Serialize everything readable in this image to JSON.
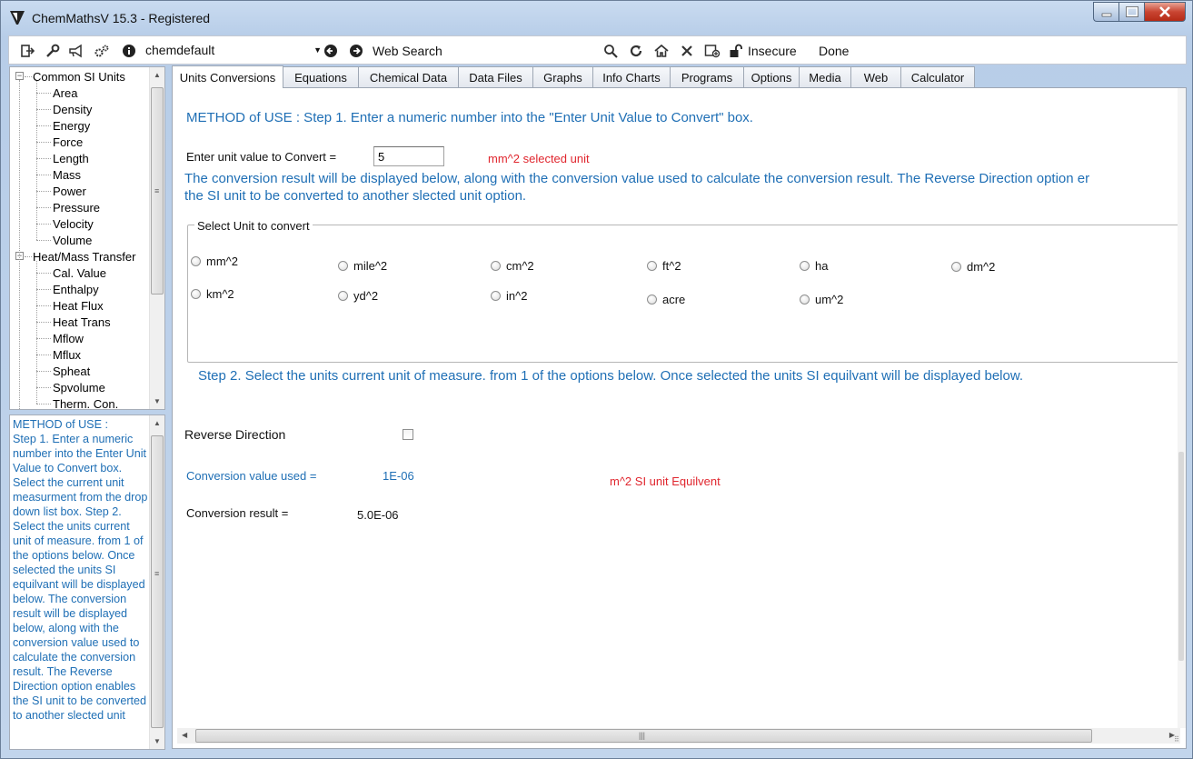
{
  "window": {
    "title": "ChemMathsV 15.3 - Registered"
  },
  "toolbar": {
    "profile": "chemdefault",
    "web_search_label": "Web Search",
    "security_label": "Insecure",
    "status_label": "Done"
  },
  "tree": {
    "groups": [
      {
        "label": "Common SI Units",
        "items": [
          "Area",
          "Density",
          "Energy",
          "Force",
          "Length",
          "Mass",
          "Power",
          "Pressure",
          "Velocity",
          "Volume"
        ]
      },
      {
        "label": "Heat/Mass Transfer",
        "items": [
          "Cal. Value",
          "Enthalpy",
          "Heat Flux",
          "Heat Trans",
          "Mflow",
          "Mflux",
          "Spheat",
          "Spvolume",
          "Therm. Con."
        ]
      }
    ]
  },
  "help": {
    "text": "METHOD of USE :\nStep  1.  Enter a numeric number into the Enter Unit Value to Convert box. Select the current unit measurment from the drop down list box. Step 2. Select the units current unit of measure. from 1 of the options below. Once selected the units SI equilvant will be displayed below. The conversion result will be displayed below, along with the conversion value used to calculate the conversion result. The Reverse Direction option enables the SI unit to be converted to another slected unit"
  },
  "tabs": [
    "Units Conversions",
    "Equations",
    "Chemical Data",
    "Data Files",
    "Graphs",
    "Info Charts",
    "Programs",
    "Options",
    "Media",
    "Web",
    "Calculator"
  ],
  "active_tab": "Units Conversions",
  "content": {
    "method_heading": "METHOD of USE : Step  1.  Enter a numeric number into the \"Enter Unit Value to Convert\" box.",
    "enter_label": "Enter unit value to Convert =",
    "enter_value": "5",
    "selected_unit_note": "mm^2 selected unit",
    "info_line1": "The conversion result will be displayed below, along with the conversion value used to calculate the conversion result. The Reverse Direction option er",
    "info_line2": "the SI unit to be converted to another slected unit option.",
    "group_title": "Select Unit to convert",
    "units_row1": [
      "mm^2",
      "mile^2",
      "cm^2",
      "ft^2",
      "ha",
      "dm^2"
    ],
    "units_row2": [
      "km^2",
      "yd^2",
      "in^2",
      "acre",
      "um^2"
    ],
    "step2": "Step 2. Select the units current unit of measure. from 1 of the options below. Once selected the units SI equilvant will be displayed below.",
    "reverse_label": "Reverse Direction",
    "conv_value_label": "Conversion value used =",
    "conv_value": "1E-06",
    "si_unit_note": "m^2  SI unit Equilvent",
    "result_label": "Conversion result =",
    "result_value": "5.0E-06"
  },
  "colors": {
    "accent_blue": "#1f6fb5",
    "note_red": "#e0262e",
    "close_red": "#c94532"
  }
}
